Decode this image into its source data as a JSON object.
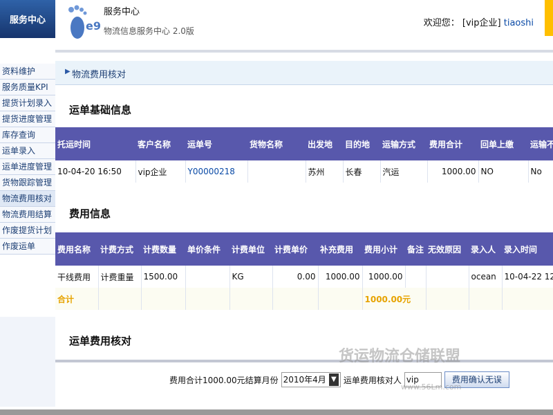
{
  "brand": {
    "label": "服务中心"
  },
  "header": {
    "title": "服务中心",
    "subtitle": "物流信息服务中心 2.0版",
    "welcome": "欢迎您：",
    "company": "[vip企业]",
    "user": "tiaoshi",
    "logo_text": "e9"
  },
  "sidebar": {
    "items": [
      {
        "label": "资料维护"
      },
      {
        "label": "服务质量KPI"
      },
      {
        "label": "提货计划录入"
      },
      {
        "label": "提货进度管理"
      },
      {
        "label": "库存查询"
      },
      {
        "label": "运单录入"
      },
      {
        "label": "运单进度管理"
      },
      {
        "label": "货物跟踪管理"
      },
      {
        "label": "物流费用核对"
      },
      {
        "label": "物流费用结算"
      },
      {
        "label": "作废提货计划"
      },
      {
        "label": "作废运单"
      }
    ]
  },
  "breadcrumb": {
    "text": "物流费用核对"
  },
  "waybill": {
    "title": "运单基础信息",
    "headers": [
      "托运时间",
      "客户名称",
      "运单号",
      "货物名称",
      "出发地",
      "目的地",
      "运输方式",
      "费用合计",
      "回单上缴",
      "运输不"
    ],
    "row": [
      "10-04-20 16:50",
      "vip企业",
      "Y00000218",
      "",
      "苏州",
      "长春",
      "汽运",
      "1000.00",
      "NO",
      "No"
    ]
  },
  "fees": {
    "title": "费用信息",
    "headers": [
      "费用名称",
      "计费方式",
      "计费数量",
      "单价条件",
      "计费单位",
      "计费单价",
      "补充费用",
      "费用小计",
      "备注",
      "无效原因",
      "录入人",
      "录入时间"
    ],
    "row": [
      "干线费用",
      "计费重量",
      "1500.00",
      "",
      "KG",
      "0.00",
      "1000.00",
      "1000.00",
      "",
      "",
      "ocean",
      "10-04-22 12:"
    ],
    "total_label": "合计",
    "total_value": "1000.00元"
  },
  "check": {
    "title": "运单费用核对",
    "summary": "费用合计1000.00元结算月份",
    "month": "2010年4月",
    "checker_label": "运单费用核对人",
    "checker_value": "vip",
    "confirm_button": "费用确认无误"
  },
  "watermark": {
    "text": "货运物流仓储联盟",
    "url": "www.56Lm.com"
  },
  "colors": {
    "table_header": "#5858ac",
    "accent": "#ffbf00",
    "total": "#e7a300"
  }
}
